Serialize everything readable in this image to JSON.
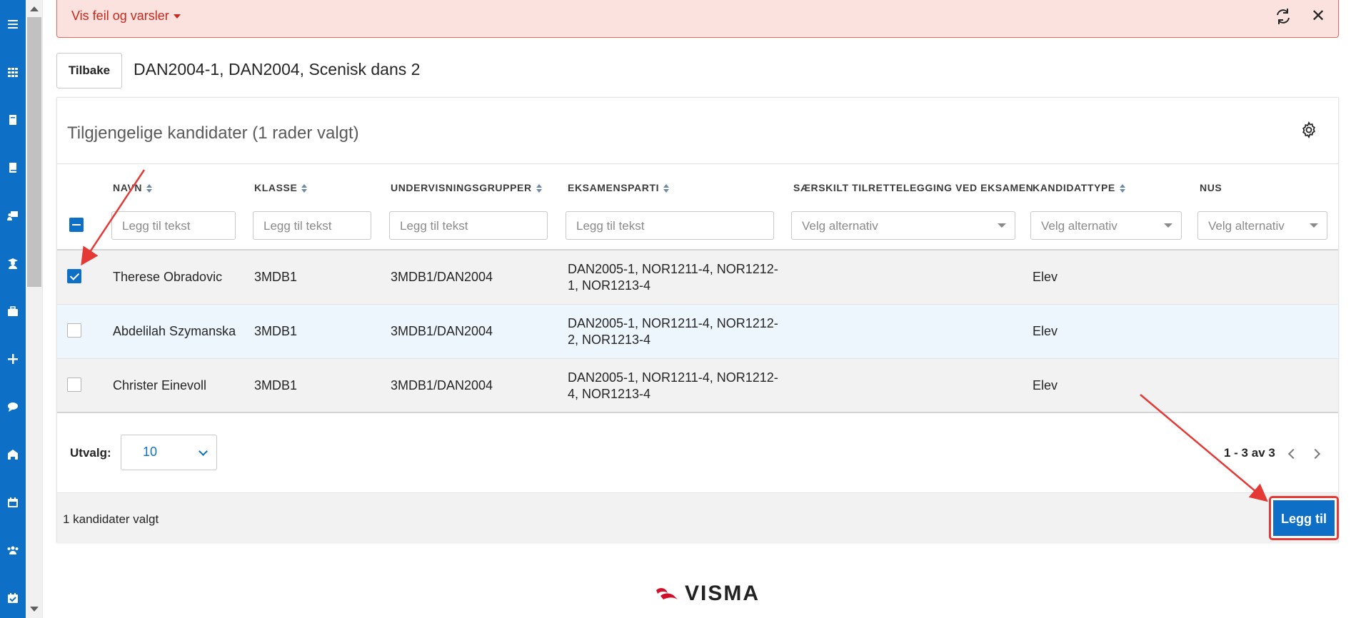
{
  "nav": {
    "icons": [
      "menu-icon",
      "apps-grid-icon",
      "book-icon",
      "book-open-icon",
      "teacher-icon",
      "student-icon",
      "briefcase-icon",
      "plus-icon",
      "chat-icon",
      "school-icon",
      "calendar-icon",
      "group-icon",
      "calendar-check-icon"
    ]
  },
  "alert": {
    "text": "Vis feil og varsler",
    "close": "✕"
  },
  "header": {
    "back_label": "Tilbake",
    "course_title": "DAN2004-1, DAN2004, Scenisk dans 2"
  },
  "card": {
    "title": "Tilgjengelige kandidater (1 rader valgt)"
  },
  "table": {
    "columns": [
      {
        "label": "NAVN",
        "sortable": true
      },
      {
        "label": "KLASSE",
        "sortable": true
      },
      {
        "label": "UNDERVISNINGSGRUPPER",
        "sortable": true
      },
      {
        "label": "EKSAMENSPARTI",
        "sortable": true
      },
      {
        "label": "SÆRSKILT TILRETTELEGGING VED EKSAMEN",
        "sortable": false
      },
      {
        "label": "KANDIDATTYPE",
        "sortable": true
      },
      {
        "label": "NUS",
        "sortable": false
      }
    ],
    "filters": {
      "text_placeholder": "Legg til tekst",
      "select_placeholder": "Velg alternativ"
    },
    "rows": [
      {
        "checked": true,
        "name": "Therese Obradovic",
        "klasse": "3MDB1",
        "gruppe": "3MDB1/DAN2004",
        "parti_1": "DAN2005-1, NOR1211-4, NOR1212-",
        "parti_2": "1, NOR1213-4",
        "tilrettelegging": "",
        "type": "Elev",
        "nus": ""
      },
      {
        "checked": false,
        "name": "Abdelilah Szymanska",
        "klasse": "3MDB1",
        "gruppe": "3MDB1/DAN2004",
        "parti_1": "DAN2005-1, NOR1211-4, NOR1212-",
        "parti_2": "2, NOR1213-4",
        "tilrettelegging": "",
        "type": "Elev",
        "nus": ""
      },
      {
        "checked": false,
        "name": "Christer Einevoll",
        "klasse": "3MDB1",
        "gruppe": "3MDB1/DAN2004",
        "parti_1": "DAN2005-1, NOR1211-4, NOR1212-",
        "parti_2": "4, NOR1213-4",
        "tilrettelegging": "",
        "type": "Elev",
        "nus": ""
      }
    ]
  },
  "pagination": {
    "utvalg_label": "Utvalg:",
    "page_size": "10",
    "range": "1 - 3 av 3"
  },
  "footer": {
    "selected_text": "1 kandidater valgt",
    "add_label": "Legg til"
  },
  "brand": {
    "name": "VISMA",
    "accent": "#0d6fc5",
    "logo_red": "#d0102b"
  }
}
